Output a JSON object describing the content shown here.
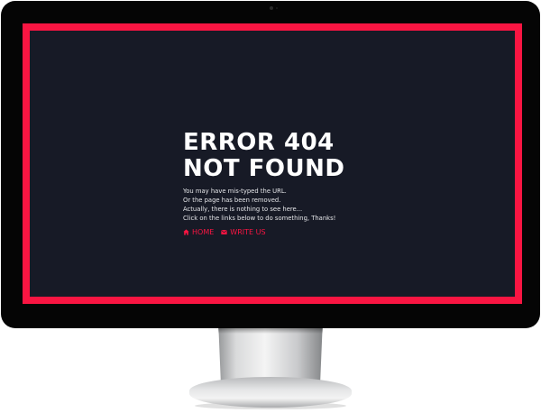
{
  "page": {
    "title_line_1": "ERROR 404",
    "title_line_2": "NOT FOUND",
    "message_lines": [
      "You may have mis-typed the URL.",
      "Or the page has been removed.",
      "Actually, there is nothing to see here...",
      "Click on the links below to do something, Thanks!"
    ]
  },
  "links": [
    {
      "label": "HOME",
      "icon": "home-icon"
    },
    {
      "label": "WRITE US",
      "icon": "mail-icon"
    }
  ],
  "colors": {
    "accent": "#fa1542",
    "screen_background": "#171a26",
    "bezel": "#050505",
    "text": "#ffffff"
  }
}
